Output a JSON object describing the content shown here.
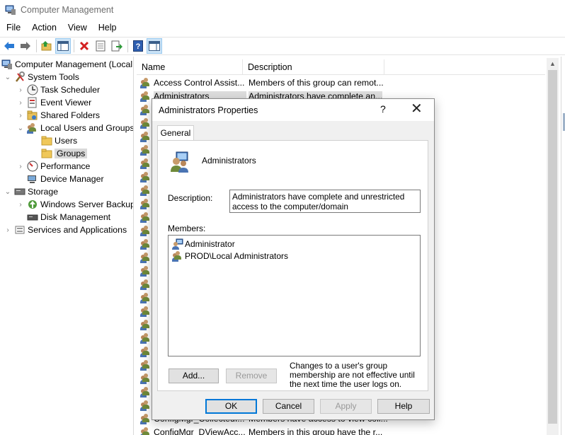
{
  "window": {
    "title": "Computer Management"
  },
  "menu": [
    "File",
    "Action",
    "View",
    "Help"
  ],
  "toolbar": {
    "icons": [
      "back-arrow-icon",
      "forward-arrow-icon",
      "up-folder-icon",
      "show-hide-tree-icon",
      "delete-icon",
      "properties-icon",
      "export-list-icon",
      "help-icon",
      "action-pane-icon"
    ]
  },
  "tree": {
    "items": [
      {
        "label": "Computer Management (Local",
        "depth": 0,
        "chevron": ""
      },
      {
        "label": "System Tools",
        "depth": 1,
        "chevron": "v"
      },
      {
        "label": "Task Scheduler",
        "depth": 2,
        "chevron": ">"
      },
      {
        "label": "Event Viewer",
        "depth": 2,
        "chevron": ">"
      },
      {
        "label": "Shared Folders",
        "depth": 2,
        "chevron": ">"
      },
      {
        "label": "Local Users and Groups",
        "depth": 2,
        "chevron": "v"
      },
      {
        "label": "Users",
        "depth": 3,
        "chevron": ""
      },
      {
        "label": "Groups",
        "depth": 3,
        "chevron": ""
      },
      {
        "label": "Performance",
        "depth": 2,
        "chevron": ">"
      },
      {
        "label": "Device Manager",
        "depth": 2,
        "chevron": ""
      },
      {
        "label": "Storage",
        "depth": 1,
        "chevron": "v"
      },
      {
        "label": "Windows Server Backup",
        "depth": 2,
        "chevron": ">"
      },
      {
        "label": "Disk Management",
        "depth": 2,
        "chevron": ""
      },
      {
        "label": "Services and Applications",
        "depth": 1,
        "chevron": ">"
      }
    ]
  },
  "list": {
    "columns": [
      "Name",
      "Description"
    ],
    "rows": [
      {
        "name": "Access Control Assist...",
        "desc": "Members of this group can remot..."
      },
      {
        "name": "Administrators",
        "desc": "Administrators have complete an..."
      },
      {
        "name": "",
        "desc": ""
      },
      {
        "name": "",
        "desc": ""
      },
      {
        "name": "",
        "desc": ""
      },
      {
        "name": "",
        "desc": ""
      },
      {
        "name": "",
        "desc": ""
      },
      {
        "name": "",
        "desc": ""
      },
      {
        "name": "",
        "desc": ""
      },
      {
        "name": "",
        "desc": ""
      },
      {
        "name": "",
        "desc": ""
      },
      {
        "name": "",
        "desc": ""
      },
      {
        "name": "",
        "desc": ""
      },
      {
        "name": "",
        "desc": ""
      },
      {
        "name": "",
        "desc": ""
      },
      {
        "name": "",
        "desc": ""
      },
      {
        "name": "",
        "desc": ""
      },
      {
        "name": "",
        "desc": ""
      },
      {
        "name": "",
        "desc": ""
      },
      {
        "name": "",
        "desc": ""
      },
      {
        "name": "",
        "desc": ""
      },
      {
        "name": "",
        "desc": ""
      },
      {
        "name": "",
        "desc": ""
      },
      {
        "name": "",
        "desc": ""
      },
      {
        "name": "",
        "desc": ""
      },
      {
        "name": "ConfigMgr_CollectedI...",
        "desc": "Members have access to view coll..."
      },
      {
        "name": "ConfigMgr_DViewAcc...",
        "desc": "Members in this group have the r..."
      }
    ]
  },
  "dialog": {
    "title": "Administrators Properties",
    "help_glyph": "?",
    "close_glyph": "✕",
    "tab": "General",
    "group_name": "Administrators",
    "description_label": "Description:",
    "description_value": "Administrators have complete and unrestricted access to the computer/domain",
    "members_label": "Members:",
    "members": [
      {
        "name": "Administrator",
        "icon": "user-icon"
      },
      {
        "name": "PROD\\Local Administrators",
        "icon": "group-icon"
      }
    ],
    "add_button": "Add...",
    "remove_button": "Remove",
    "note": "Changes to a user's group membership are not effective until the next time the user logs on.",
    "ok_button": "OK",
    "cancel_button": "Cancel",
    "apply_button": "Apply",
    "help_button": "Help"
  }
}
